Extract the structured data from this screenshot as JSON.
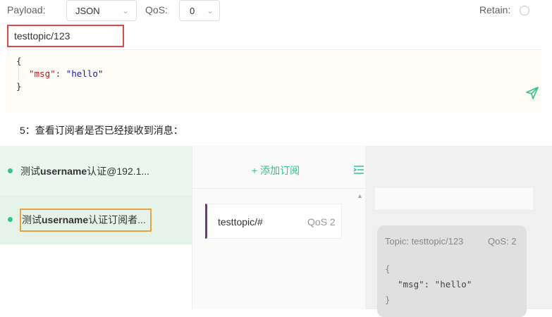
{
  "publish": {
    "payload_label": "Payload:",
    "payload_format": "JSON",
    "qos_label": "QoS:",
    "qos_value": "0",
    "retain_label": "Retain:",
    "topic_value": "testtopic/123",
    "payload_lines": {
      "open": "{",
      "key": "\"msg\"",
      "colon": ": ",
      "value": "\"hello\"",
      "close": "}"
    }
  },
  "caption": "5：查看订阅者是否已经接收到消息：",
  "connections": [
    {
      "prefix": "测试",
      "bold": "username",
      "suffix": "认证@192.1...",
      "status_color": "#34c388"
    },
    {
      "prefix": "测试",
      "bold": "username",
      "suffix": "认证订阅者...",
      "status_color": "#34c388"
    }
  ],
  "subscriptions": {
    "add_label": "+ 添加订阅",
    "items": [
      {
        "topic": "testtopic/#",
        "qos": "QoS 2",
        "color": "#6b3a8a"
      }
    ]
  },
  "message": {
    "topic_line": "Topic: testtopic/123",
    "qos": "QoS: 2",
    "lines": {
      "open": "{",
      "body": "\"msg\": \"hello\"",
      "close": "}"
    }
  },
  "colors": {
    "accent": "#34c388",
    "highlight_red": "#e04848",
    "highlight_orange": "#e8a23a"
  }
}
